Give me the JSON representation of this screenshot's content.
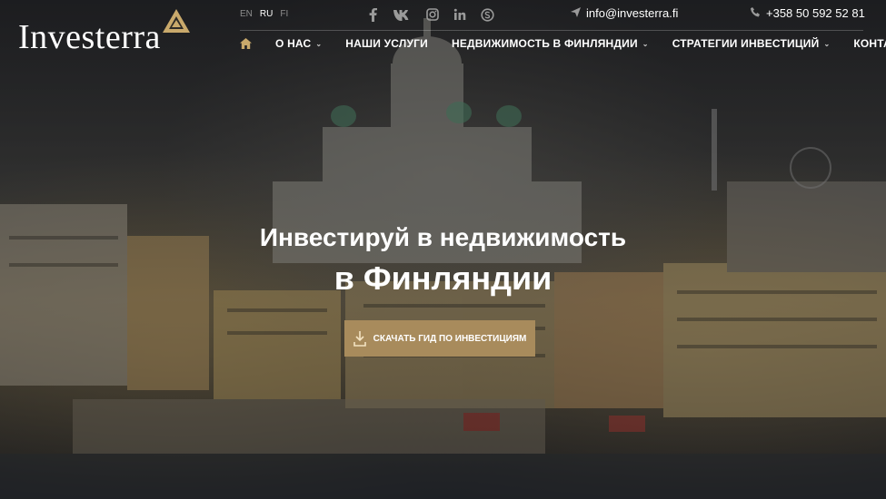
{
  "brand": {
    "name": "Investerra",
    "accent": "#c9a96b",
    "button_color": "#a88b5c"
  },
  "languages": [
    {
      "code": "EN",
      "active": false
    },
    {
      "code": "RU",
      "active": true
    },
    {
      "code": "FI",
      "active": false
    }
  ],
  "social": [
    "facebook-icon",
    "vk-icon",
    "instagram-icon",
    "linkedin-icon",
    "skype-icon"
  ],
  "contact": {
    "email": "info@investerra.fi",
    "phone": "+358 50 592 52 81"
  },
  "nav": {
    "items": [
      {
        "label": "О НАС",
        "dropdown": true
      },
      {
        "label": "НАШИ УСЛУГИ",
        "dropdown": false
      },
      {
        "label": "НЕДВИЖИМОСТЬ В ФИНЛЯНДИИ",
        "dropdown": true
      },
      {
        "label": "СТРАТЕГИИ ИНВЕСТИЦИЙ",
        "dropdown": true
      },
      {
        "label": "КОНТАКТЫ",
        "dropdown": false
      }
    ]
  },
  "hero": {
    "title": "Инвестируй в недвижимость",
    "subtitle": "в Финляндии",
    "cta_label": "СКАЧАТЬ ГИД ПО ИНВЕСТИЦИЯМ"
  }
}
